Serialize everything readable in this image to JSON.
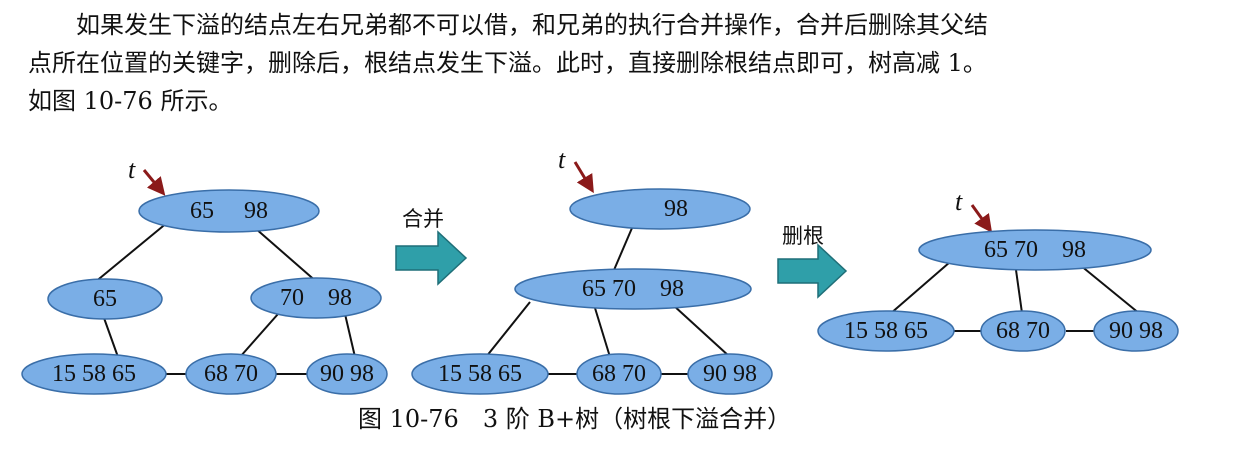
{
  "text": {
    "line1": "如果发生下溢的结点左右兄弟都不可以借，和兄弟的执行合并操作，合并后删除其父结",
    "line2": "点所在位置的关键字，删除后，根结点发生下溢。此时，直接删除根结点即可，树高减 1。",
    "line3": "如图 10-76 所示。"
  },
  "figure": {
    "caption": "图 10-76　3 阶 B+树（树根下溢合并）",
    "pointer_label": "t",
    "arrows": [
      "合并",
      "删根"
    ],
    "trees": [
      {
        "root": "65　 98",
        "internal": [
          "65",
          "70　98"
        ],
        "leaves": [
          "15  58  65",
          "68 70",
          "90 98"
        ]
      },
      {
        "root": "98",
        "internal": [
          "65  70　98"
        ],
        "leaves": [
          "15  58  65",
          "68 70",
          "90 98"
        ]
      },
      {
        "root": "65  70　98",
        "leaves": [
          "15  58  65",
          "68 70",
          "90 98"
        ]
      }
    ]
  },
  "colors": {
    "node_fill": "#7aaee6",
    "node_stroke": "#3a6ea8",
    "arrow_fill": "#2f9fa9",
    "pointer_arrow": "#8b1a1a"
  }
}
